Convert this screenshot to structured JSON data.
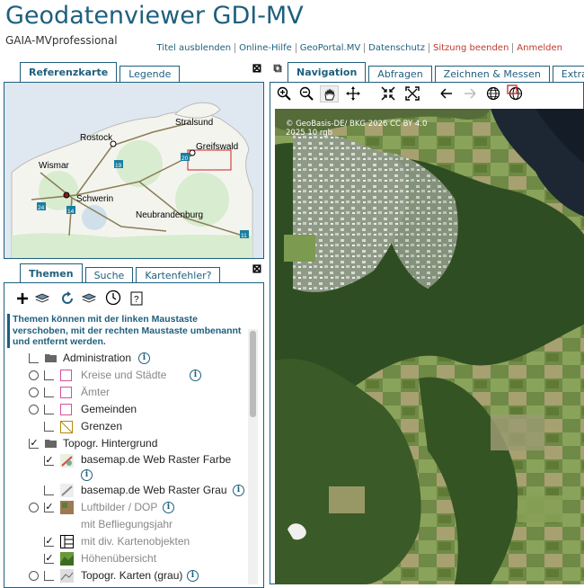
{
  "app": {
    "title": "Geodatenviewer GDI-MV",
    "subtitle": "GAIA-MVprofessional"
  },
  "toplinks": [
    {
      "label": "Titel ausblenden",
      "color": "#1e5f7d"
    },
    {
      "label": "Online-Hilfe",
      "color": "#1e5f7d"
    },
    {
      "label": "GeoPortal.MV",
      "color": "#1e5f7d"
    },
    {
      "label": "Datenschutz",
      "color": "#1e5f7d"
    },
    {
      "label": "Sitzung beenden",
      "color": "#c0392b"
    },
    {
      "label": "Anmelden",
      "color": "#c0392b"
    }
  ],
  "left_top_tabs": [
    "Referenzkarte",
    "Legende"
  ],
  "overview": {
    "cities": [
      "Stralsund",
      "Rostock",
      "Greifswald",
      "Wismar",
      "Schwerin",
      "Neubrandenburg"
    ],
    "road_numbers": [
      "19",
      "20",
      "24",
      "14",
      "11"
    ]
  },
  "left_bottom_tabs": [
    "Themen",
    "Suche",
    "Kartenfehler?"
  ],
  "themes_info": "Themen können mit der linken Maustaste verschoben, mit der rechten Maustaste umbenannt und entfernt werden.",
  "layers": [
    {
      "label": "Administration",
      "info": "i",
      "radio": false,
      "checked": false,
      "icon": "folder-icon",
      "gray": false
    },
    {
      "label": "Kreise und Städte",
      "info": "i",
      "radio": true,
      "checked": false,
      "icon": "pink-square-icon",
      "gray": true
    },
    {
      "label": "Ämter",
      "info": "",
      "radio": true,
      "checked": false,
      "icon": "pink-square-icon",
      "gray": true
    },
    {
      "label": "Gemeinden",
      "info": "",
      "radio": true,
      "checked": false,
      "icon": "pink-square-icon",
      "gray": false
    },
    {
      "label": "Grenzen",
      "info": "",
      "radio": false,
      "checked": false,
      "icon": "boundary-icon",
      "gray": false
    },
    {
      "label": "Topogr. Hintergrund",
      "info": "",
      "radio": false,
      "checked": true,
      "icon": "folder-icon",
      "gray": false
    },
    {
      "label": "basemap.de Web Raster Farbe",
      "info": "i",
      "radio": false,
      "checked": true,
      "icon": "raster-color-icon",
      "gray": false
    },
    {
      "label": "basemap.de Web Raster Grau",
      "info": "i",
      "radio": false,
      "checked": false,
      "icon": "raster-gray-icon",
      "gray": false
    },
    {
      "label": "Luftbilder / DOP",
      "info": "i",
      "radio": true,
      "checked": true,
      "icon": "aerial-icon",
      "gray": true
    },
    {
      "label": "mit Befliegungsjahr",
      "info": "",
      "radio": false,
      "checked": false,
      "icon": "",
      "gray": true
    },
    {
      "label": "mit div. Kartenobjekten",
      "info": "",
      "radio": false,
      "checked": true,
      "icon": "map-objects-icon",
      "gray": true
    },
    {
      "label": "Höhenübersicht",
      "info": "",
      "radio": false,
      "checked": true,
      "icon": "relief-icon",
      "gray": true
    },
    {
      "label": "Topogr. Karten (grau)",
      "info": "i",
      "radio": true,
      "checked": false,
      "icon": "topo-gray-icon",
      "gray": false
    }
  ],
  "right_tabs": [
    "Navigation",
    "Abfragen",
    "Zeichnen & Messen",
    "Extras"
  ],
  "map_attribution": {
    "line1": "© GeoBasis-DE/ BKG 2026 CC BY 4.0",
    "line2": "2025 10 rgb"
  },
  "colors": {
    "accent": "#1e5f7d",
    "link_red": "#c0392b"
  }
}
